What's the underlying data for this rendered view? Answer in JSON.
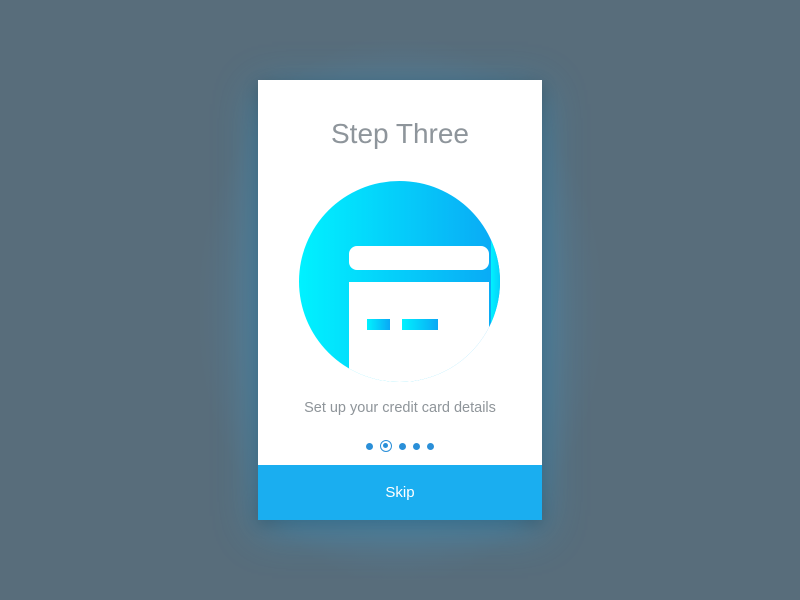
{
  "screen": {
    "title": "Step Three",
    "subtitle": "Set up your credit card details",
    "icon": "credit-card-icon",
    "pager": {
      "total": 5,
      "current": 2,
      "active_color": "#2a8fd8"
    },
    "skip_label": "Skip"
  },
  "colors": {
    "background": "#586d7b",
    "card": "#ffffff",
    "accent": "#1aaef0",
    "gradient_start": "#00f0ff",
    "gradient_end": "#0aa8f5"
  }
}
